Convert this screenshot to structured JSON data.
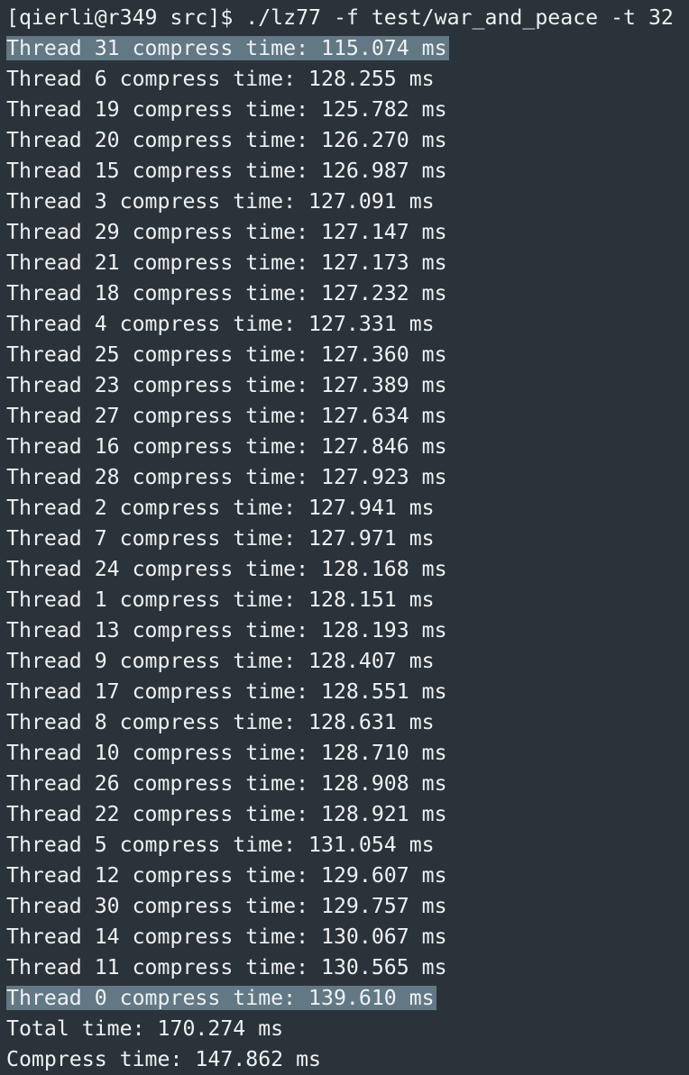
{
  "terminal": {
    "prompt": "[qierli@r349 src]$ ./lz77 -f test/war_and_peace -t 32",
    "lines": [
      {
        "text": "Thread 31 compress time: 115.074 ms",
        "highlighted": true
      },
      {
        "text": "Thread 6 compress time: 128.255 ms",
        "highlighted": false
      },
      {
        "text": "Thread 19 compress time: 125.782 ms",
        "highlighted": false
      },
      {
        "text": "Thread 20 compress time: 126.270 ms",
        "highlighted": false
      },
      {
        "text": "Thread 15 compress time: 126.987 ms",
        "highlighted": false
      },
      {
        "text": "Thread 3 compress time: 127.091 ms",
        "highlighted": false
      },
      {
        "text": "Thread 29 compress time: 127.147 ms",
        "highlighted": false
      },
      {
        "text": "Thread 21 compress time: 127.173 ms",
        "highlighted": false
      },
      {
        "text": "Thread 18 compress time: 127.232 ms",
        "highlighted": false
      },
      {
        "text": "Thread 4 compress time: 127.331 ms",
        "highlighted": false
      },
      {
        "text": "Thread 25 compress time: 127.360 ms",
        "highlighted": false
      },
      {
        "text": "Thread 23 compress time: 127.389 ms",
        "highlighted": false
      },
      {
        "text": "Thread 27 compress time: 127.634 ms",
        "highlighted": false
      },
      {
        "text": "Thread 16 compress time: 127.846 ms",
        "highlighted": false
      },
      {
        "text": "Thread 28 compress time: 127.923 ms",
        "highlighted": false
      },
      {
        "text": "Thread 2 compress time: 127.941 ms",
        "highlighted": false
      },
      {
        "text": "Thread 7 compress time: 127.971 ms",
        "highlighted": false
      },
      {
        "text": "Thread 24 compress time: 128.168 ms",
        "highlighted": false
      },
      {
        "text": "Thread 1 compress time: 128.151 ms",
        "highlighted": false
      },
      {
        "text": "Thread 13 compress time: 128.193 ms",
        "highlighted": false
      },
      {
        "text": "Thread 9 compress time: 128.407 ms",
        "highlighted": false
      },
      {
        "text": "Thread 17 compress time: 128.551 ms",
        "highlighted": false
      },
      {
        "text": "Thread 8 compress time: 128.631 ms",
        "highlighted": false
      },
      {
        "text": "Thread 10 compress time: 128.710 ms",
        "highlighted": false
      },
      {
        "text": "Thread 26 compress time: 128.908 ms",
        "highlighted": false
      },
      {
        "text": "Thread 22 compress time: 128.921 ms",
        "highlighted": false
      },
      {
        "text": "Thread 5 compress time: 131.054 ms",
        "highlighted": false
      },
      {
        "text": "Thread 12 compress time: 129.607 ms",
        "highlighted": false
      },
      {
        "text": "Thread 30 compress time: 129.757 ms",
        "highlighted": false
      },
      {
        "text": "Thread 14 compress time: 130.067 ms",
        "highlighted": false
      },
      {
        "text": "Thread 11 compress time: 130.565 ms",
        "highlighted": false
      },
      {
        "text": "Thread 0 compress time: 139.610 ms",
        "highlighted": true
      }
    ],
    "total_time": "Total time: 170.274 ms",
    "compress_time": "Compress time: 147.862 ms",
    "colors": {
      "background": "#2b333a",
      "foreground": "#eef1f3",
      "selection": "#627884"
    }
  }
}
